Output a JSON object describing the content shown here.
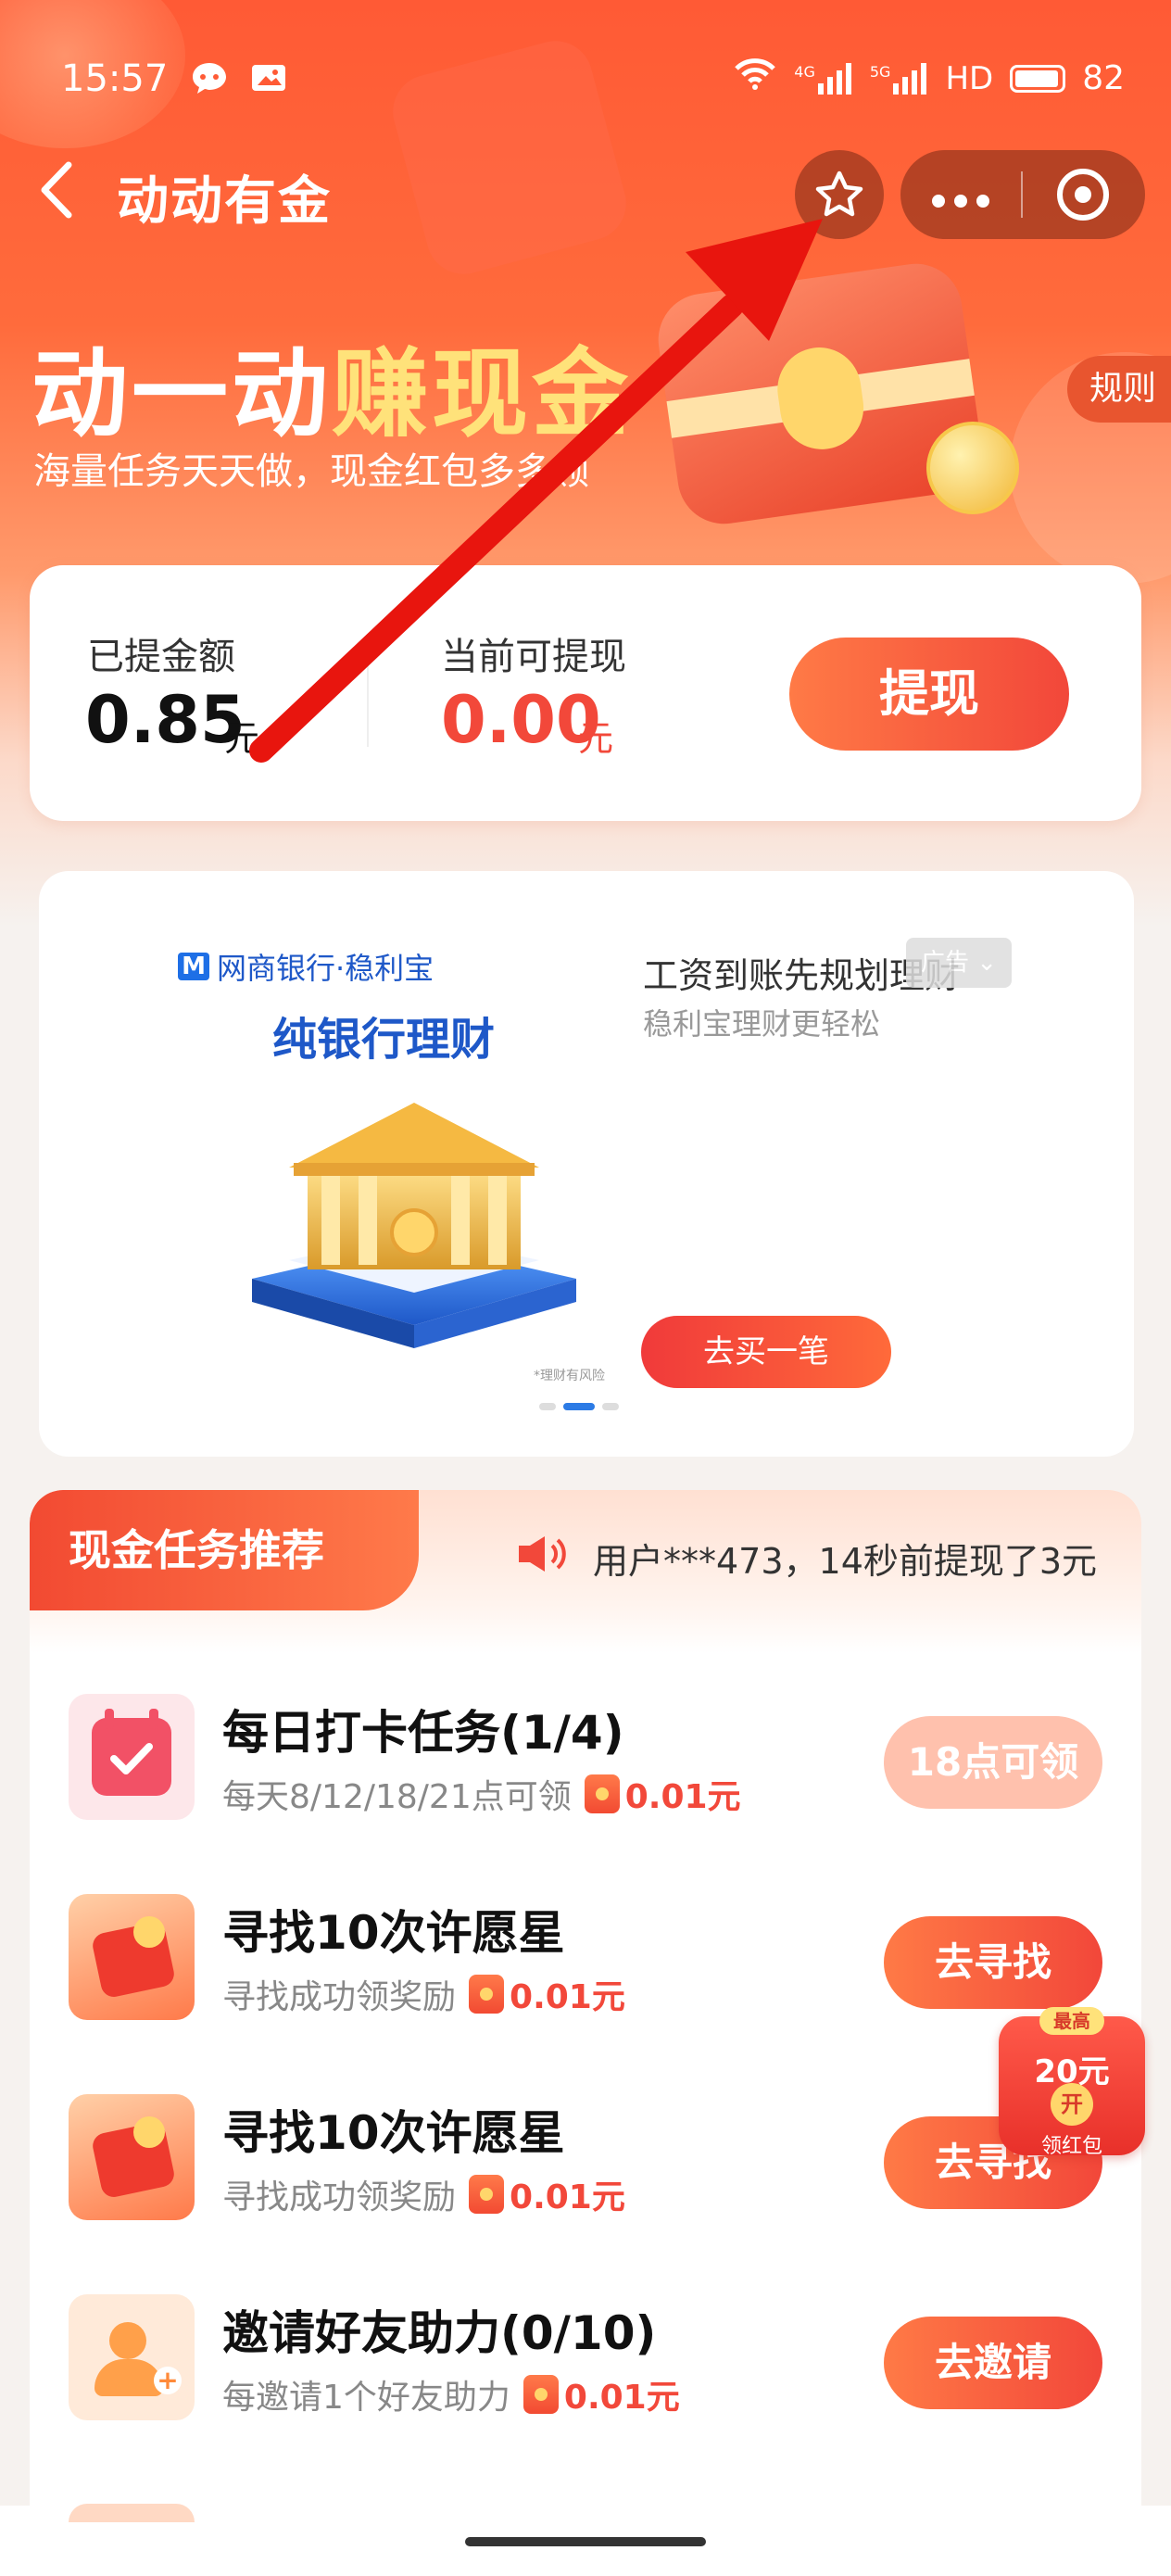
{
  "status_bar": {
    "time": "15:57",
    "left_icons": [
      "chat-bubble-icon",
      "image-icon"
    ],
    "right_icons": [
      "wifi-icon",
      "signal-4g-icon",
      "signal-5g-icon"
    ],
    "network_4g": "4G",
    "network_5g": "5G",
    "hd_label": "HD",
    "battery": "82"
  },
  "nav": {
    "title": "动动有金",
    "back_icon": "chevron-left-icon",
    "star_icon": "star-icon",
    "more_icon": "more-dots-icon",
    "close_icon": "target-icon"
  },
  "banner": {
    "title_white": "动一动",
    "title_yellow": "赚现金",
    "subtitle": "海量任务天天做，现金红包多多领",
    "rules": "规则"
  },
  "balance": {
    "withdrawn_label": "已提金额",
    "withdrawn_value": "0.85",
    "withdrawn_unit": "元",
    "available_label": "当前可提现",
    "available_value": "0.00",
    "available_unit": "元",
    "withdraw_button": "提现"
  },
  "ad": {
    "brand": "网商银行·稳利宝",
    "brand_logo": "M",
    "product": "纯银行理财",
    "risk_note": "*理财有风险",
    "headline": "工资到账先规划理财",
    "subline": "稳利宝理财更轻松",
    "ad_badge": "广告",
    "buy_button": "去买一笔",
    "carousel": {
      "pages": 3,
      "active_page": 1
    }
  },
  "tasks": {
    "section_title": "现金任务推荐",
    "notice": "用户***473，14秒前提现了3元",
    "notice_icon": "speaker-icon",
    "items": [
      {
        "name": "每日打卡任务(1/4)",
        "desc": "每天8/12/18/21点可领",
        "reward": "0.01元",
        "button": "18点可领",
        "icon": "calendar-check-icon",
        "disabled": true
      },
      {
        "name": "寻找10次许愿星",
        "desc": "寻找成功领奖励",
        "reward": "0.01元",
        "button": "去寻找",
        "icon": "gift-icon",
        "disabled": false
      },
      {
        "name": "寻找10次许愿星",
        "desc": "寻找成功领奖励",
        "reward": "0.01元",
        "button": "去寻找",
        "icon": "gift-icon",
        "disabled": false
      },
      {
        "name": "邀请好友助力(0/10)",
        "desc": "每邀请1个好友助力",
        "reward": "0.01元",
        "button": "去邀请",
        "icon": "invite-friend-icon",
        "disabled": false
      }
    ]
  },
  "floating_red_packet": {
    "tag": "最高",
    "amount": "20元",
    "open": "开",
    "label": "领红包"
  },
  "colors": {
    "primary_red": "#f2473a",
    "hero_orange": "#ff5a35",
    "ad_blue": "#1e58c8",
    "annotation_arrow": "#e8150e"
  }
}
